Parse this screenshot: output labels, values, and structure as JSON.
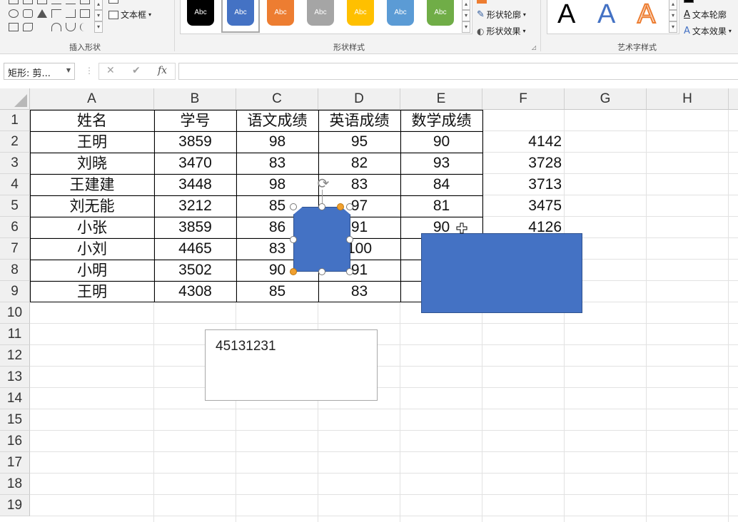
{
  "ribbon": {
    "insert_shapes_group_label": "插入形状",
    "text_box_label": "文本框",
    "shape_styles_group_label": "形状样式",
    "style_swatch_text": "Abc",
    "style_swatch_colors": [
      "#000000",
      "#4472c4",
      "#ed7d31",
      "#a5a5a5",
      "#ffc000",
      "#5b9bd5",
      "#70ad47"
    ],
    "shape_outline_label": "形状轮廓",
    "shape_effects_label": "形状效果",
    "wordart_group_label": "艺术字样式",
    "wordart_letter": "A",
    "text_outline_label": "文本轮廓",
    "text_effects_label": "文本效果"
  },
  "formula_bar": {
    "name_box_value": "矩形: 剪...",
    "cancel_symbol": "✕",
    "enter_symbol": "✔",
    "fx_symbol": "fx",
    "formula_value": ""
  },
  "sheet": {
    "columns": [
      "A",
      "B",
      "C",
      "D",
      "E",
      "F",
      "G",
      "H"
    ],
    "rows": [
      "1",
      "2",
      "3",
      "4",
      "5",
      "6",
      "7",
      "8",
      "9",
      "10",
      "11",
      "12",
      "13",
      "14",
      "15",
      "16",
      "17",
      "18",
      "19"
    ],
    "header": [
      "姓名",
      "学号",
      "语文成绩",
      "英语成绩",
      "数学成绩"
    ],
    "records": [
      [
        "王明",
        "3859",
        "98",
        "95",
        "90",
        "4142"
      ],
      [
        "刘晓",
        "3470",
        "83",
        "82",
        "93",
        "3728"
      ],
      [
        "王建建",
        "3448",
        "98",
        "83",
        "84",
        "3713"
      ],
      [
        "刘无能",
        "3212",
        "85",
        "97",
        "81",
        "3475"
      ],
      [
        "小张",
        "3859",
        "86",
        "91",
        "90",
        "4126"
      ],
      [
        "小刘",
        "4465",
        "83",
        "100",
        "",
        ""
      ],
      [
        "小明",
        "3502",
        "90",
        "91",
        "",
        ""
      ],
      [
        "王明",
        "4308",
        "85",
        "83",
        "",
        ""
      ]
    ]
  },
  "text_box": {
    "content": "45131231"
  },
  "colors": {
    "shape_fill": "#4472c4",
    "shape_border": "#2f528f",
    "adjust_handle": "#f0a030"
  }
}
